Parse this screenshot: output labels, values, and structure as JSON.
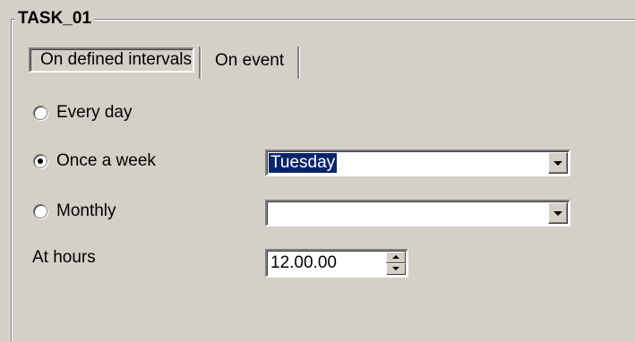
{
  "group_title": "TASK_01",
  "tabs": [
    {
      "label": "On defined intervals",
      "active": true
    },
    {
      "label": "On event",
      "active": false
    }
  ],
  "schedule": {
    "every_day": {
      "label": "Every day",
      "checked": false
    },
    "once_a_week": {
      "label": "Once a week",
      "checked": true,
      "value": "Tuesday"
    },
    "monthly": {
      "label": "Monthly",
      "checked": false,
      "value": ""
    }
  },
  "at_hours": {
    "label": "At hours",
    "value": "12.00.00"
  },
  "icons": {
    "dropdown": "chevron-down-icon",
    "spin_up": "arrow-up-icon",
    "spin_down": "arrow-down-icon"
  }
}
